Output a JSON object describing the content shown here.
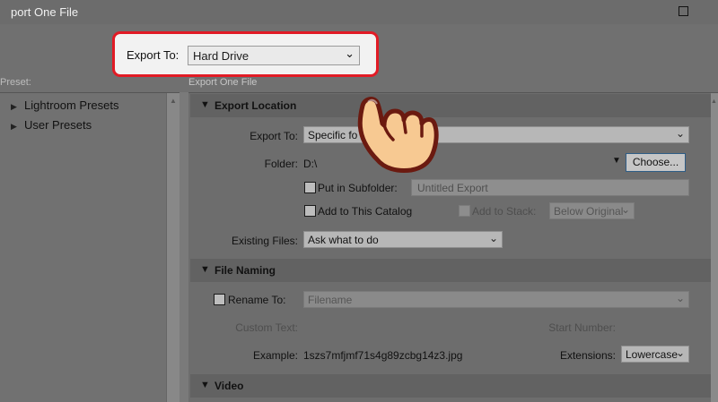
{
  "window": {
    "title": "port One File"
  },
  "export_to": {
    "label": "Export To:",
    "value": "Hard Drive"
  },
  "preset_panel": {
    "label": "Preset:",
    "items": [
      {
        "label": "Lightroom Presets"
      },
      {
        "label": "User Presets"
      }
    ]
  },
  "settings_panel": {
    "label": "Export One File"
  },
  "export_location": {
    "header": "Export Location",
    "export_to_label": "Export To:",
    "export_to_value": "Specific fo",
    "folder_label": "Folder:",
    "folder_value": "D:\\",
    "choose_label": "Choose...",
    "subfolder_label": "Put in Subfolder:",
    "subfolder_placeholder": "Untitled Export",
    "add_catalog_label": "Add to This Catalog",
    "add_stack_label": "Add to Stack:",
    "stack_value": "Below Original",
    "existing_label": "Existing Files:",
    "existing_value": "Ask what to do"
  },
  "file_naming": {
    "header": "File Naming",
    "rename_label": "Rename To:",
    "rename_value": "Filename",
    "custom_text_label": "Custom Text:",
    "start_number_label": "Start Number:",
    "example_label": "Example:",
    "example_value": "1szs7mfjmf71s4g89zcbg14z3.jpg",
    "extensions_label": "Extensions:",
    "extensions_value": "Lowercase"
  },
  "video": {
    "header": "Video"
  },
  "colors": {
    "highlight": "#e11b25",
    "hand_fill": "#f7c992",
    "hand_outline": "#6b1a10"
  },
  "icons": {
    "dropdown": "chevron-down-icon",
    "collapse": "triangle-down-icon",
    "expand": "triangle-right-icon",
    "pointer": "hand-pointer-icon"
  }
}
